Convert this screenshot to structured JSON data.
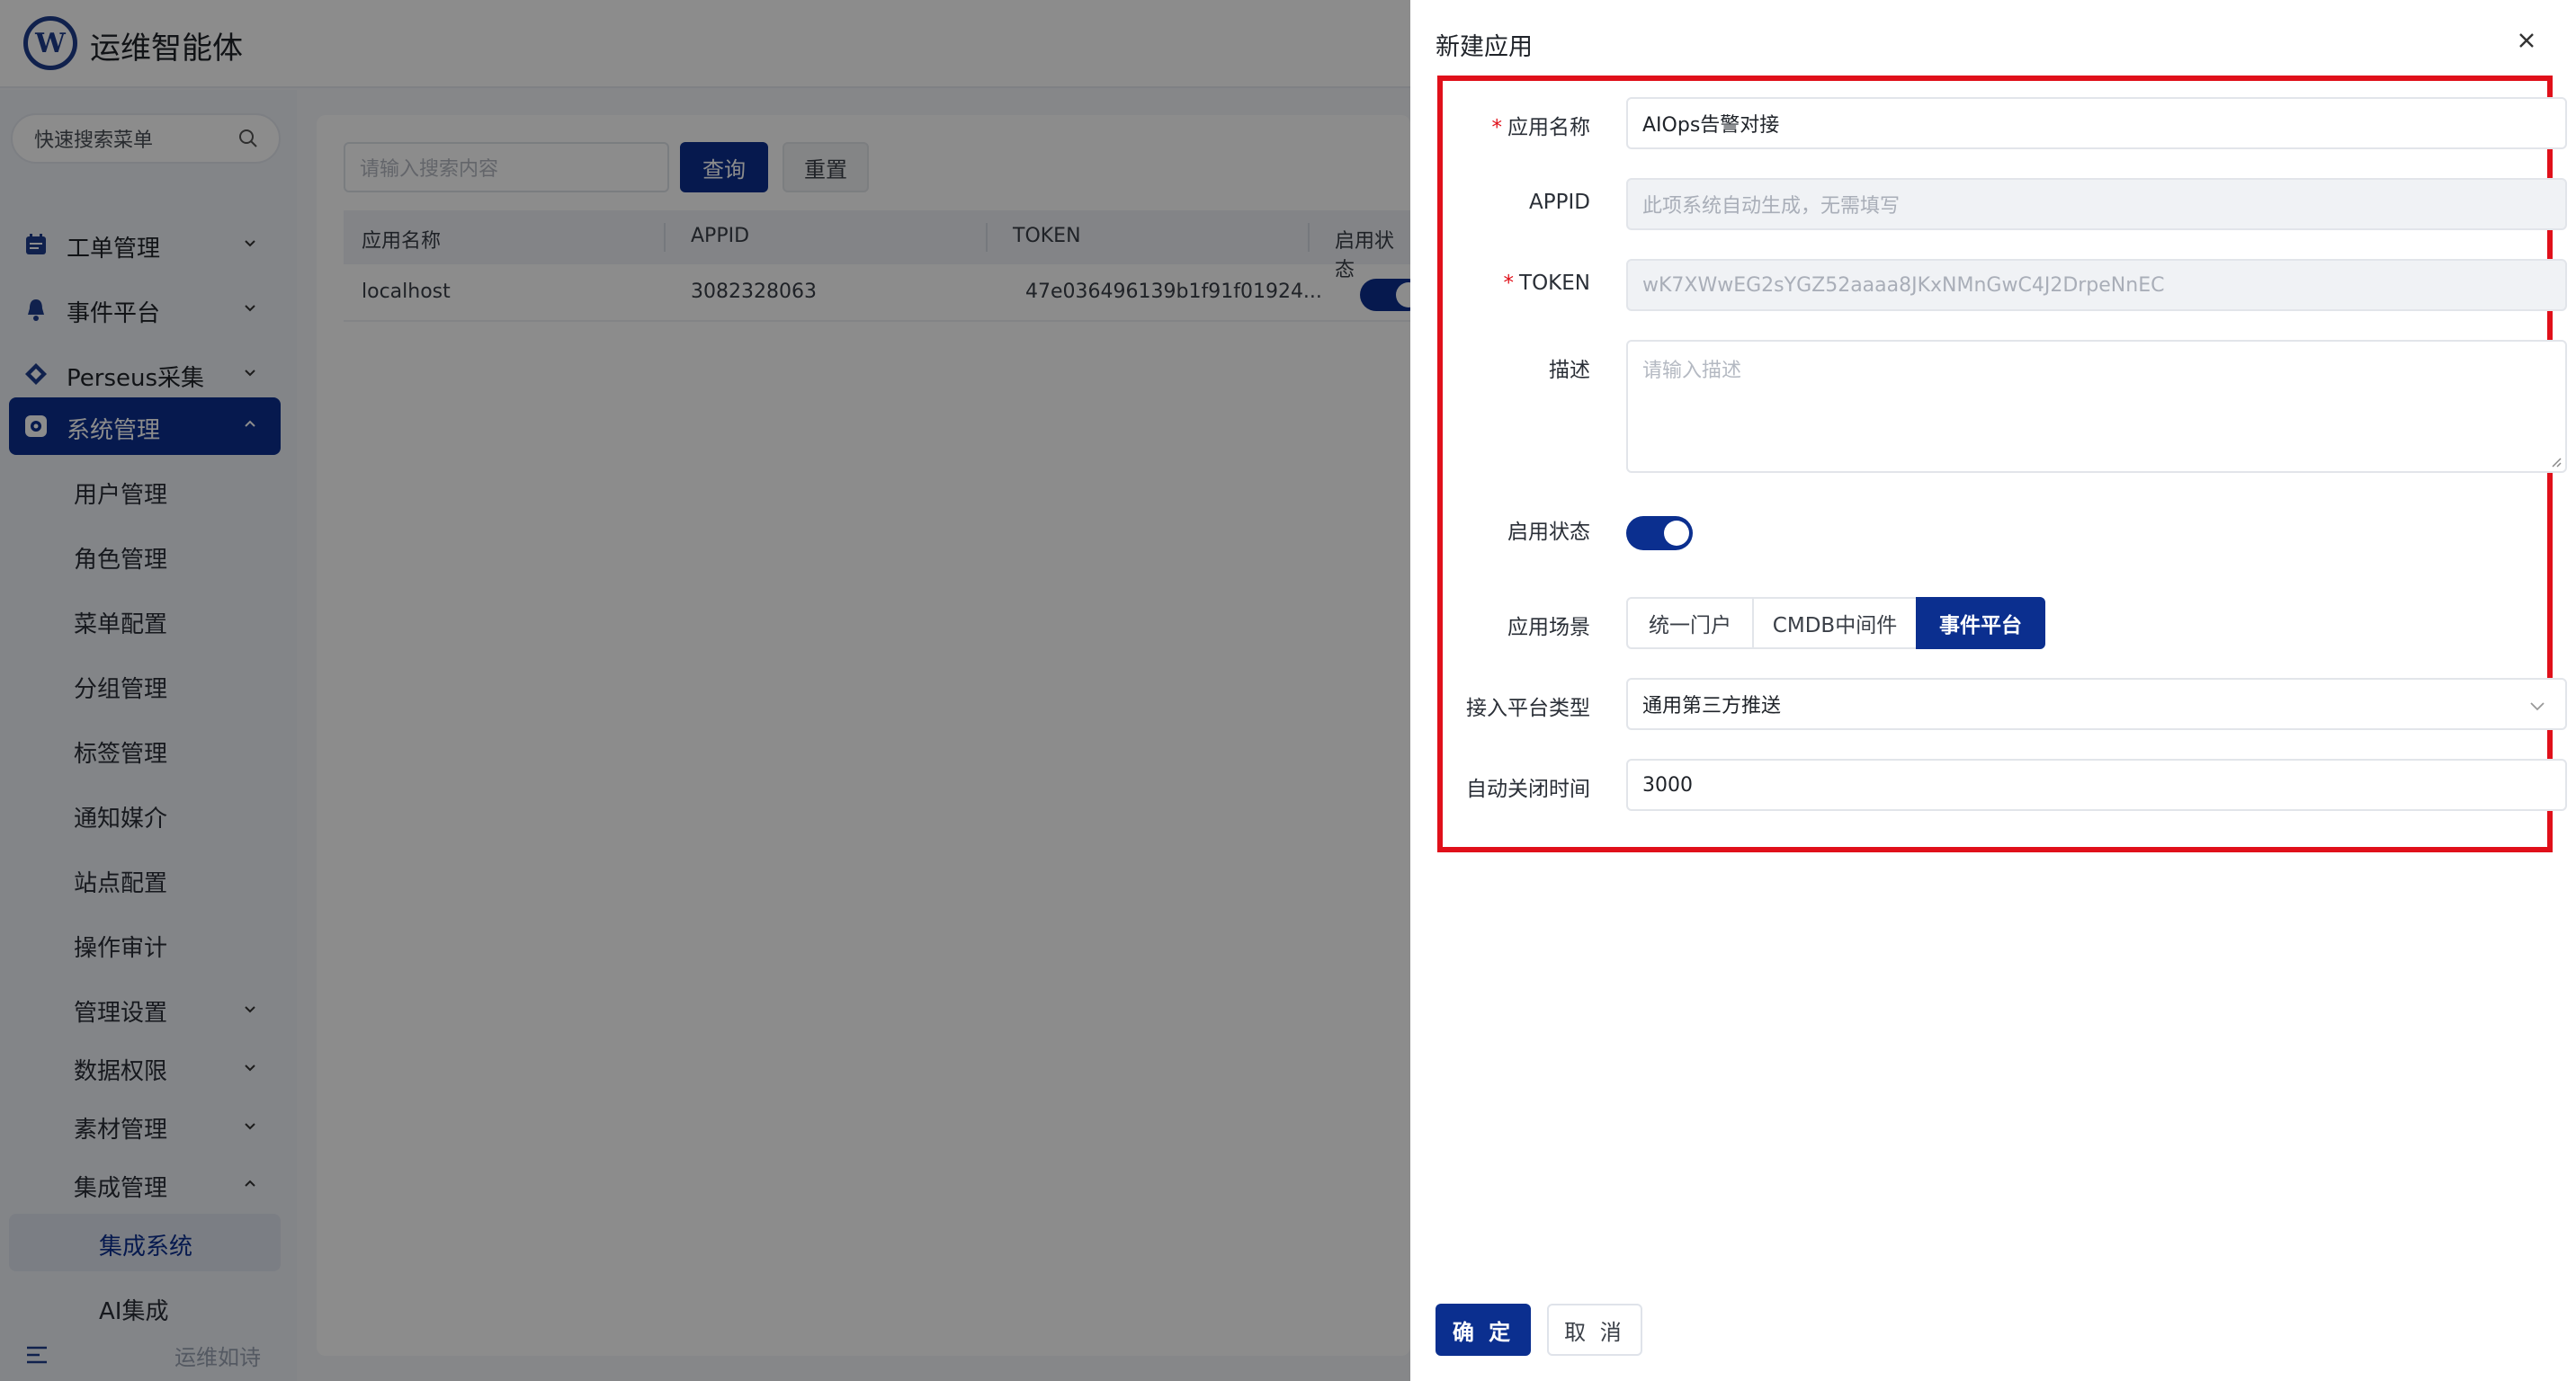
{
  "app": {
    "title": "运维智能体",
    "logo_letter": "W"
  },
  "sidebar": {
    "search_placeholder": "快速搜索菜单",
    "items": [
      {
        "label": "工单管理",
        "icon": "calendar-icon"
      },
      {
        "label": "事件平台",
        "icon": "bell-icon"
      },
      {
        "label": "Perseus采集",
        "icon": "diamond-icon"
      },
      {
        "label": "系统管理",
        "icon": "gear-icon",
        "active": true
      }
    ],
    "sub_items": [
      "用户管理",
      "角色管理",
      "菜单配置",
      "分组管理",
      "标签管理",
      "通知媒介",
      "站点配置",
      "操作审计",
      "管理设置",
      "数据权限",
      "素材管理",
      "集成管理"
    ],
    "deep_items": [
      "集成系统",
      "AI集成"
    ],
    "footer_text": "运维如诗"
  },
  "main": {
    "search_placeholder": "请输入搜索内容",
    "query_label": "查询",
    "reset_label": "重置",
    "columns": [
      "应用名称",
      "APPID",
      "TOKEN",
      "启用状态"
    ],
    "rows": [
      {
        "name": "localhost",
        "appid": "3082328063",
        "token": "47e036496139b1f91f01924...",
        "enabled": true
      }
    ]
  },
  "drawer": {
    "title": "新建应用",
    "fields": {
      "name_label": "应用名称",
      "name_value": "AIOps告警对接",
      "appid_label": "APPID",
      "appid_placeholder": "此项系统自动生成，无需填写",
      "token_label": "TOKEN",
      "token_value": "wK7XWwEG2sYGZ52aaaa8JKxNMnGwC4J2DrpeNnEC",
      "desc_label": "描述",
      "desc_placeholder": "请输入描述",
      "status_label": "启用状态",
      "scene_label": "应用场景",
      "scene_options": [
        "统一门户",
        "CMDB中间件",
        "事件平台"
      ],
      "scene_selected": "事件平台",
      "platform_label": "接入平台类型",
      "platform_value": "通用第三方推送",
      "close_time_label": "自动关闭时间",
      "close_time_value": "3000"
    },
    "ok_label": "确 定",
    "cancel_label": "取 消"
  },
  "colors": {
    "primary": "#0b2f8f",
    "highlight": "#e0101a"
  }
}
